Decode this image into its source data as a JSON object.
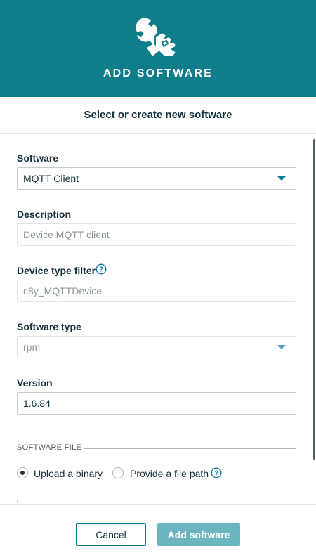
{
  "header": {
    "title": "ADD SOFTWARE",
    "icon": "wrench-hand-icon"
  },
  "subtitle": "Select or create new software",
  "form": {
    "software": {
      "label": "Software",
      "value": "MQTT Client"
    },
    "description": {
      "label": "Description",
      "placeholder": "Device MQTT client"
    },
    "device_type_filter": {
      "label": "Device type filter",
      "placeholder": "c8y_MQTTDevice"
    },
    "software_type": {
      "label": "Software type",
      "value": "rpm"
    },
    "version": {
      "label": "Version",
      "value": "1.6.84"
    }
  },
  "software_file": {
    "section_title": "SOFTWARE FILE",
    "options": [
      {
        "label": "Upload a binary",
        "checked": true
      },
      {
        "label": "Provide a file path",
        "checked": false
      }
    ]
  },
  "footer": {
    "cancel_label": "Cancel",
    "add_label": "Add software"
  },
  "colors": {
    "header_bg": "#0f7d8a",
    "accent": "#1479a0",
    "primary_button": "#6bb5be"
  }
}
